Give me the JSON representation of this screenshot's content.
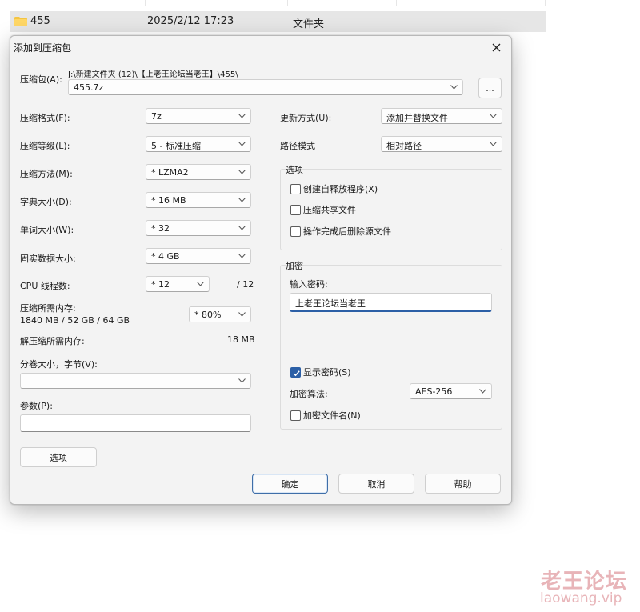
{
  "background_row": {
    "folder_name": "455",
    "modified": "2025/2/12 17:23",
    "type": "文件夹"
  },
  "dialog": {
    "title": "添加到压缩包",
    "archive": {
      "label": "压缩包(A):",
      "path": "J:\\新建文件夹 (12)\\【上老王论坛当老王】\\455\\",
      "filename": "455.7z",
      "browse_label": "..."
    },
    "left": {
      "format": {
        "label": "压缩格式(F):",
        "value": "7z"
      },
      "level": {
        "label": "压缩等级(L):",
        "value": "5 - 标准压缩"
      },
      "method": {
        "label": "压缩方法(M):",
        "value": "*  LZMA2"
      },
      "dict": {
        "label": "字典大小(D):",
        "value": "*  16 MB"
      },
      "word": {
        "label": "单词大小(W):",
        "value": "*  32"
      },
      "solid": {
        "label": "固实数据大小:",
        "value": "*  4 GB"
      },
      "cpu": {
        "label": "CPU 线程数:",
        "value": "*  12",
        "max": "/ 12"
      },
      "mem_compress": {
        "label": "压缩所需内存:",
        "detail": "1840 MB / 52 GB / 64 GB",
        "value": "*  80%"
      },
      "mem_decompress": {
        "label": "解压缩所需内存:",
        "value": "18 MB"
      },
      "split": {
        "label": "分卷大小，字节(V):",
        "value": ""
      },
      "params": {
        "label": "参数(P):",
        "value": ""
      },
      "options_button": "选项"
    },
    "right": {
      "update": {
        "label": "更新方式(U):",
        "value": "添加并替换文件"
      },
      "pathmode": {
        "label": "路径模式",
        "value": "相对路径"
      },
      "options_group": {
        "title": "选项",
        "sfx": "创建自释放程序(X)",
        "shared": "压缩共享文件",
        "delete": "操作完成后删除源文件"
      },
      "encrypt_group": {
        "title": "加密",
        "pw_label": "输入密码:",
        "pw_value": "上老王论坛当老王",
        "show_pw": "显示密码(S)",
        "method_label": "加密算法:",
        "method_value": "AES-256",
        "encrypt_names": "加密文件名(N)"
      }
    },
    "buttons": {
      "ok": "确定",
      "cancel": "取消",
      "help": "帮助"
    }
  },
  "watermark": {
    "cn": "老王论坛",
    "en": "laowang.vip"
  },
  "colors": {
    "accent": "#2b5fa6",
    "watermark": "#e8b4b8"
  }
}
